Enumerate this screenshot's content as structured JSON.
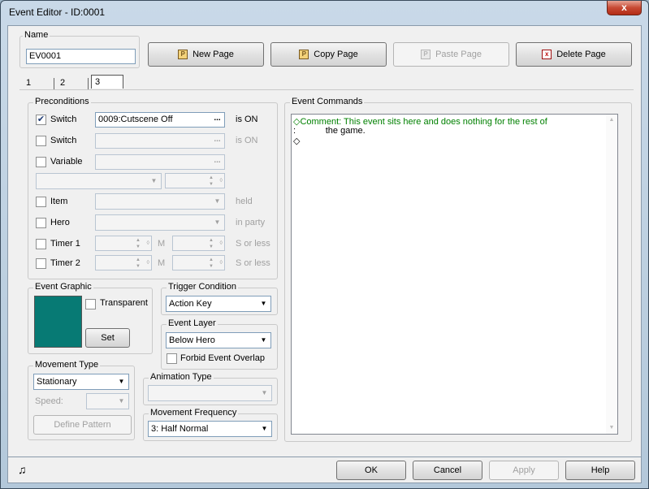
{
  "window": {
    "title": "Event Editor - ID:0001",
    "close_glyph": "x"
  },
  "name": {
    "label": "Name",
    "value": "EV0001"
  },
  "page_buttons": {
    "new_page": "New Page",
    "copy_page": "Copy Page",
    "paste_page": "Paste Page",
    "delete_page": "Delete Page"
  },
  "tabs": [
    "1",
    "2",
    "3"
  ],
  "active_tab": "3",
  "preconditions": {
    "label": "Preconditions",
    "switch1": {
      "label": "Switch",
      "value": "0009:Cutscene Off",
      "suffix": "is ON",
      "checked": true
    },
    "switch2": {
      "label": "Switch",
      "value": "",
      "suffix": "is ON",
      "checked": false
    },
    "variable": {
      "label": "Variable",
      "value": "",
      "checked": false
    },
    "item": {
      "label": "Item",
      "suffix": "held",
      "checked": false
    },
    "hero": {
      "label": "Hero",
      "suffix": "in party",
      "checked": false
    },
    "timer1": {
      "label": "Timer 1",
      "m": "M",
      "suffix": "S or less",
      "checked": false
    },
    "timer2": {
      "label": "Timer 2",
      "m": "M",
      "suffix": "S or less",
      "checked": false
    },
    "dots": "..."
  },
  "event_graphic": {
    "label": "Event Graphic",
    "transparent_label": "Transparent",
    "transparent_checked": false,
    "set_label": "Set",
    "swatch_color": "#077a74"
  },
  "trigger": {
    "label": "Trigger Condition",
    "value": "Action Key"
  },
  "event_layer": {
    "label": "Event Layer",
    "value": "Below Hero",
    "forbid_label": "Forbid Event Overlap",
    "forbid_checked": false
  },
  "movement_type": {
    "label": "Movement Type",
    "value": "Stationary",
    "speed_label": "Speed:",
    "speed_value": "",
    "define_pattern": "Define Pattern"
  },
  "animation_type": {
    "label": "Animation Type",
    "value": ""
  },
  "movement_frequency": {
    "label": "Movement Frequency",
    "value": "3: Half Normal"
  },
  "event_commands": {
    "label": "Event Commands",
    "lines": [
      "◇Comment: This event sits here and does nothing for the rest of",
      ":            the game.",
      "◇"
    ],
    "comment_color": "#008000"
  },
  "footer": {
    "ok": "OK",
    "cancel": "Cancel",
    "apply": "Apply",
    "help": "Help",
    "music_icon": "music-note-icon"
  },
  "checkmark": "✔",
  "arrow_down": "▼"
}
